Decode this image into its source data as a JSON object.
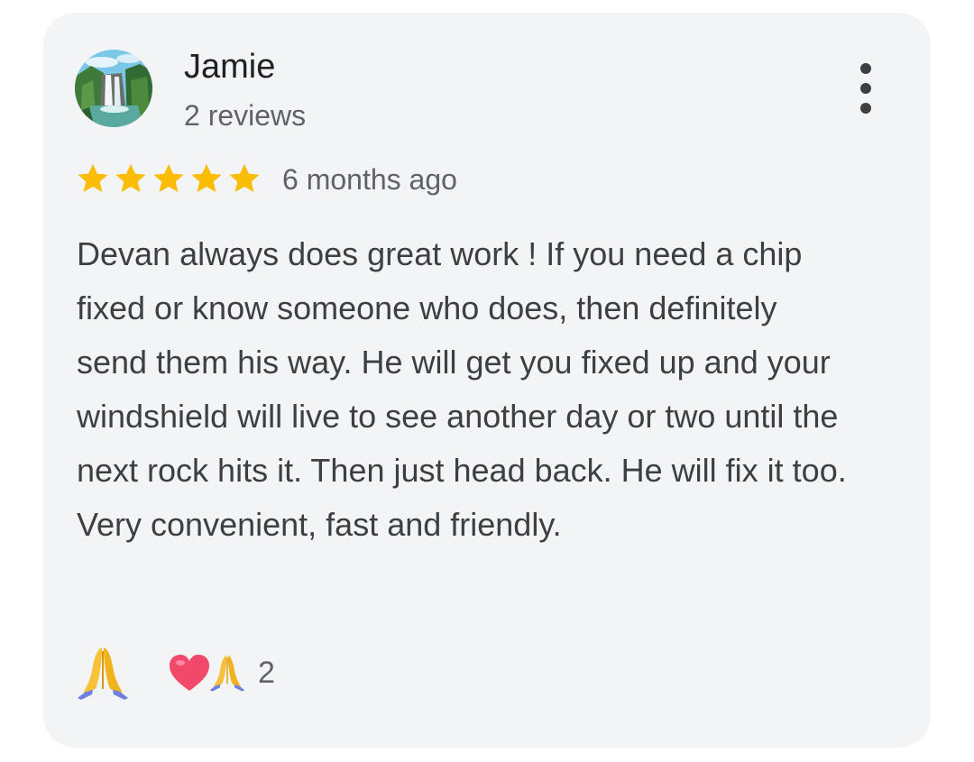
{
  "review": {
    "author": {
      "name": "Jamie",
      "reviews_count": "2 reviews",
      "avatar_icon": "waterfall-avatar"
    },
    "rating": 5,
    "max_rating": 5,
    "time": "6 months ago",
    "text": "Devan always does great work ! If you need a chip fixed or know someone who does, then definitely send them his way. He will get you fixed up and your windshield will live to see another day or two until the next rock hits it. Then just head back. He will fix it too. Very convenient, fast and friendly.",
    "more_options_icon": "more-vert-icon",
    "reactions": [
      {
        "icons": [
          "folded-hands-icon"
        ],
        "count": ""
      },
      {
        "icons": [
          "heart-icon",
          "folded-hands-icon"
        ],
        "count": "2"
      }
    ]
  },
  "colors": {
    "card_background": "#f3f4f6",
    "star": "#fbbc04",
    "name_text": "#202124",
    "secondary_text": "#5f6368",
    "body_text": "#3c4043"
  }
}
